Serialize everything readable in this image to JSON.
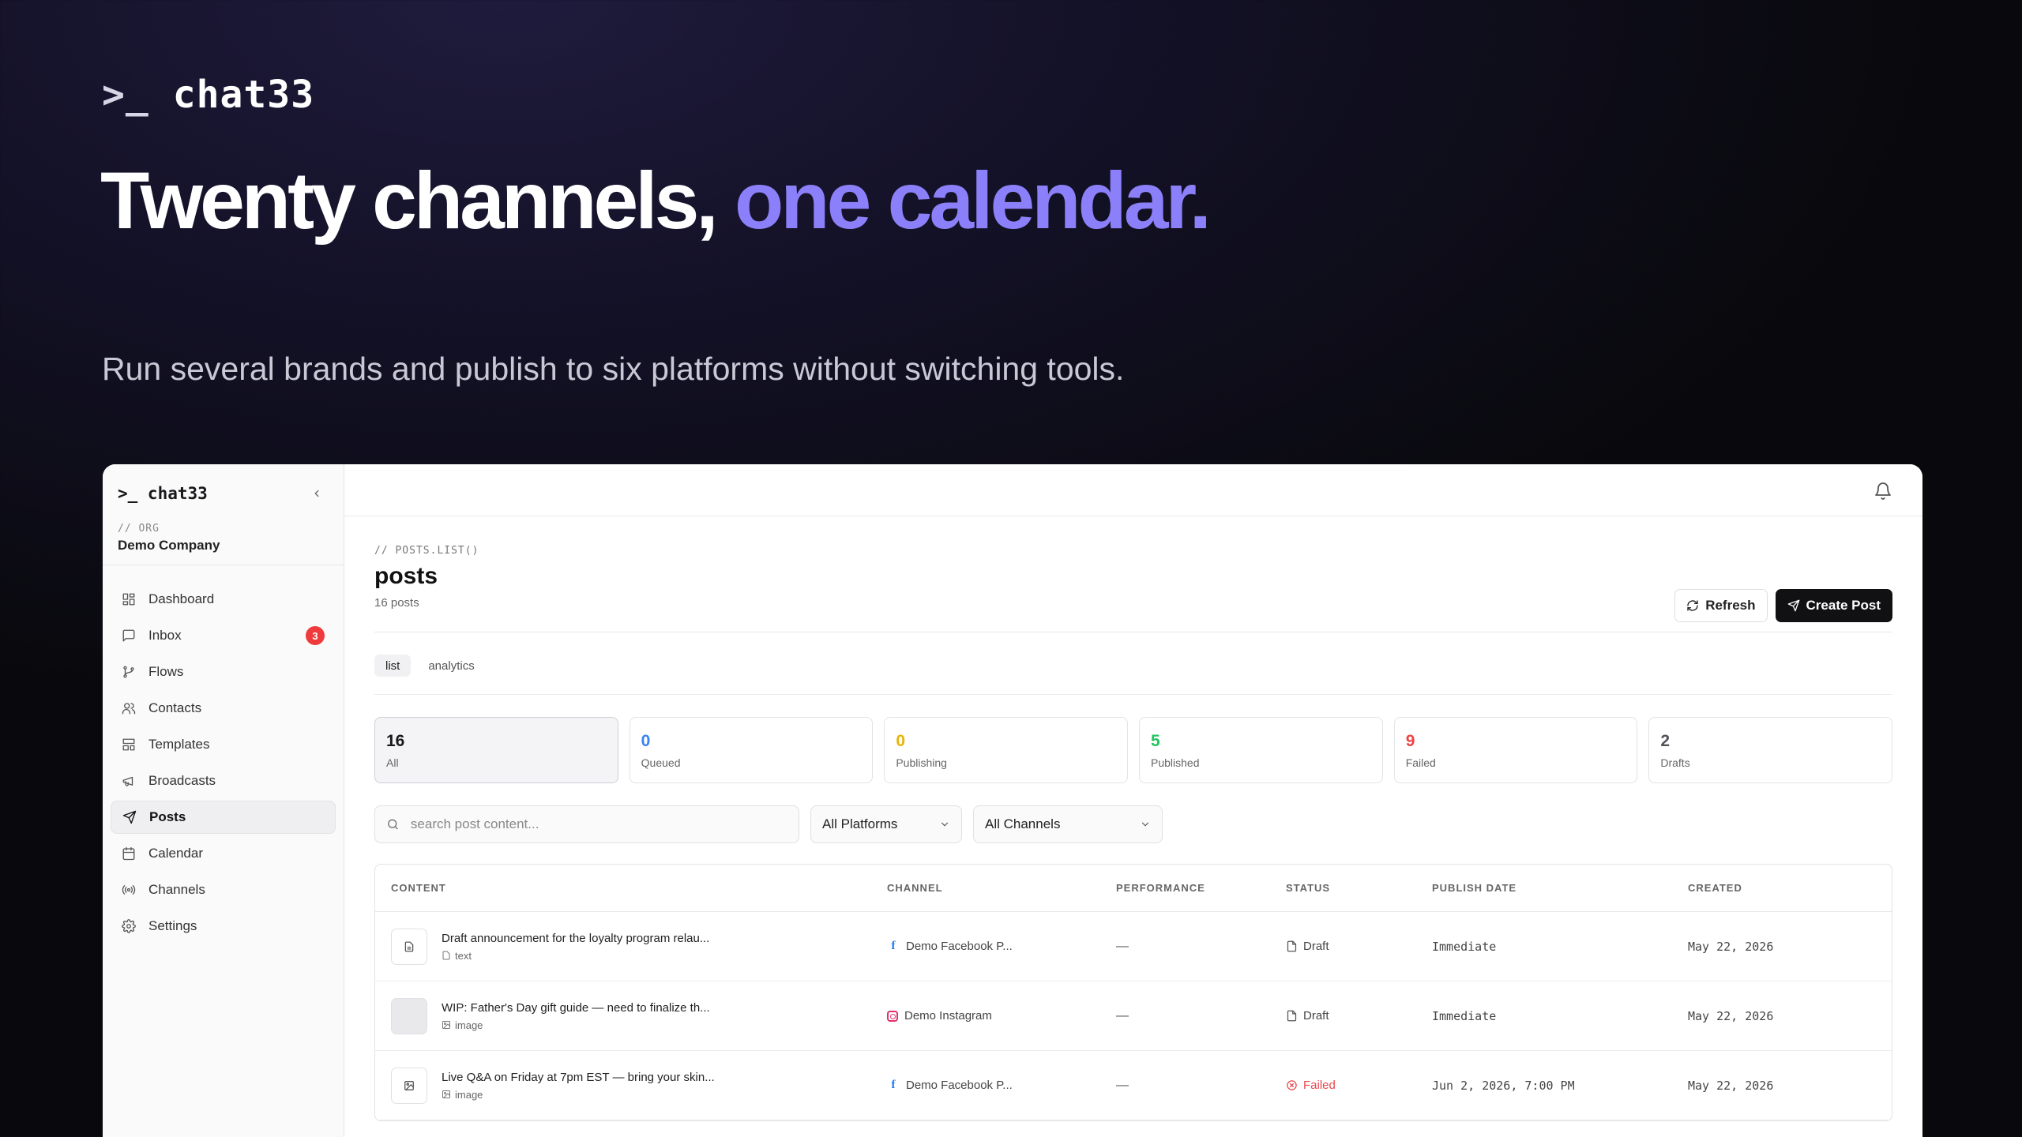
{
  "hero": {
    "brand_prompt": ">_",
    "brand_name": "chat33",
    "headline_main": "Twenty channels,",
    "headline_accent": "one calendar.",
    "subline": "Run several brands and publish to six platforms without switching tools."
  },
  "colors": {
    "accent": "#8b80f9",
    "queued": "#3b82f6",
    "publishing": "#eab308",
    "published": "#22c55e",
    "failed": "#ef4444",
    "badge": "#ef3b3b"
  },
  "sidebar": {
    "brand": ">_ chat33",
    "org_label": "// ORG",
    "org_name": "Demo Company",
    "items": [
      {
        "label": "Dashboard",
        "icon": "dashboard-icon"
      },
      {
        "label": "Inbox",
        "icon": "inbox-icon",
        "badge": "3"
      },
      {
        "label": "Flows",
        "icon": "flows-icon"
      },
      {
        "label": "Contacts",
        "icon": "contacts-icon"
      },
      {
        "label": "Templates",
        "icon": "templates-icon"
      },
      {
        "label": "Broadcasts",
        "icon": "megaphone-icon"
      },
      {
        "label": "Posts",
        "icon": "send-icon",
        "active": true
      },
      {
        "label": "Calendar",
        "icon": "calendar-icon"
      },
      {
        "label": "Channels",
        "icon": "radio-icon"
      },
      {
        "label": "Settings",
        "icon": "gear-icon"
      }
    ]
  },
  "page": {
    "kicker": "// POSTS.LIST()",
    "title": "posts",
    "count": "16 posts",
    "refresh_label": "Refresh",
    "create_label": "Create Post",
    "tabs": [
      {
        "label": "list",
        "active": true
      },
      {
        "label": "analytics"
      }
    ]
  },
  "stats": [
    {
      "value": "16",
      "label": "All"
    },
    {
      "value": "0",
      "label": "Queued"
    },
    {
      "value": "0",
      "label": "Publishing"
    },
    {
      "value": "5",
      "label": "Published"
    },
    {
      "value": "9",
      "label": "Failed"
    },
    {
      "value": "2",
      "label": "Drafts"
    }
  ],
  "filters": {
    "search_placeholder": "search post content...",
    "platform": "All Platforms",
    "channel": "All Channels"
  },
  "table": {
    "columns": [
      "CONTENT",
      "CHANNEL",
      "PERFORMANCE",
      "STATUS",
      "PUBLISH DATE",
      "CREATED"
    ],
    "rows": [
      {
        "text": "Draft announcement for the loyalty program relau...",
        "type": "text",
        "channel": "Demo Facebook P...",
        "platform": "facebook",
        "performance": "—",
        "status": "Draft",
        "publish_date": "Immediate",
        "created": "May 22, 2026"
      },
      {
        "text": "WIP: Father's Day gift guide — need to finalize th...",
        "type": "image",
        "channel": "Demo Instagram",
        "platform": "instagram",
        "performance": "—",
        "status": "Draft",
        "publish_date": "Immediate",
        "created": "May 22, 2026"
      },
      {
        "text": "Live Q&A on Friday at 7pm EST — bring your skin...",
        "type": "image",
        "channel": "Demo Facebook P...",
        "platform": "facebook",
        "performance": "—",
        "status": "Failed",
        "publish_date": "Jun 2, 2026, 7:00 PM",
        "created": "May 22, 2026"
      }
    ]
  }
}
